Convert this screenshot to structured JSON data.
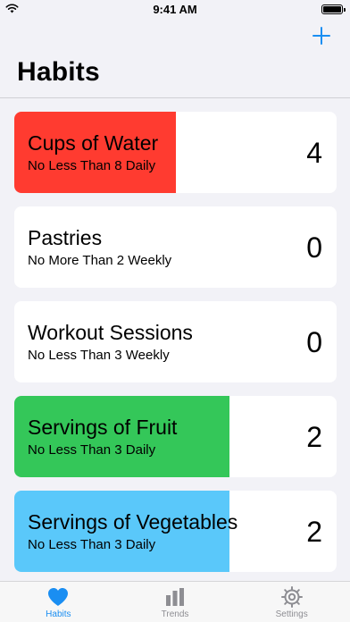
{
  "status_bar": {
    "time": "9:41 AM"
  },
  "header": {
    "title": "Habits",
    "add_icon": "plus-icon",
    "accent_color": "#1a8ef2"
  },
  "habits": [
    {
      "name": "Cups of Water",
      "goal": "No Less Than 8 Daily",
      "count": "4",
      "progress": 0.5,
      "fill_color": "#ff3b30"
    },
    {
      "name": "Pastries",
      "goal": "No More Than 2 Weekly",
      "count": "0",
      "progress": 0,
      "fill_color": "#ffffff"
    },
    {
      "name": "Workout Sessions",
      "goal": "No Less Than 3 Weekly",
      "count": "0",
      "progress": 0,
      "fill_color": "#ffffff"
    },
    {
      "name": "Servings of Fruit",
      "goal": "No Less Than 3 Daily",
      "count": "2",
      "progress": 0.667,
      "fill_color": "#34c759"
    },
    {
      "name": "Servings of Vegetables",
      "goal": "No Less Than 3 Daily",
      "count": "2",
      "progress": 0.667,
      "fill_color": "#5ac8fa"
    }
  ],
  "tab_bar": {
    "tabs": [
      {
        "label": "Habits",
        "icon": "heart-icon",
        "active": true
      },
      {
        "label": "Trends",
        "icon": "bar-chart-icon",
        "active": false
      },
      {
        "label": "Settings",
        "icon": "gear-icon",
        "active": false
      }
    ]
  }
}
